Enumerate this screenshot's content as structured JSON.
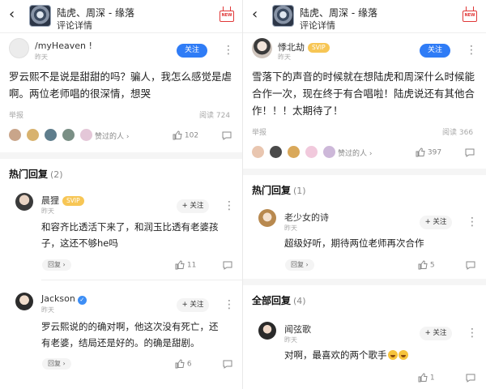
{
  "left": {
    "header": {
      "back_glyph": "‹",
      "title": "陆虎、周深 - 缘落",
      "subtitle": "评论详情",
      "new_badge": "NEW"
    },
    "post": {
      "user": "/myHeaven !",
      "time": "昨天",
      "follow": "关注",
      "text_line1": "罗云熙不是说是甜甜的吗？骗人，我怎么感觉是虐",
      "text_line2": "啊。两位老师唱的很深情，想哭",
      "report": "举报",
      "reads": "阅读 724",
      "liked_people": "赞过的人 ›",
      "likes": "102"
    },
    "hot_section": {
      "title": "热门回复",
      "count": "(2)"
    },
    "replies": [
      {
        "user": "晨狸",
        "badge": "SVIP",
        "time": "昨天",
        "follow": "+ 关注",
        "line1": "和容齐比透活下来了，和润玉比透有老婆孩",
        "line2": "子，这还不够he吗",
        "reply_btn": "回复 ›",
        "likes": "11"
      },
      {
        "user": "Jackson",
        "time": "昨天",
        "follow": "+ 关注",
        "line1": "罗云熙说的的确对啊，他这次没有死亡，还",
        "line2": "有老婆，结局还是好的。的确是甜剧。",
        "reply_btn": "回复 ›",
        "likes": "6"
      }
    ]
  },
  "right": {
    "header": {
      "back_glyph": "‹",
      "title": "陆虎、周深 - 缘落",
      "subtitle": "评论详情",
      "new_badge": "NEW"
    },
    "post": {
      "user": "悸北劫",
      "badge": "SVIP",
      "time": "昨天",
      "follow": "关注",
      "text_line1": "雪落下的声音的时候就在想陆虎和周深什么时候能",
      "text_line2": "合作一次，现在终于有合唱啦！陆虎说还有其他合",
      "text_line3": "作！！！太期待了！",
      "report": "举报",
      "reads": "阅读 366",
      "liked_people": "赞过的人 ›",
      "likes": "397"
    },
    "hot_section": {
      "title": "热门回复",
      "count": "(1)"
    },
    "hot_reply": {
      "user": "老少女的诗",
      "time": "昨天",
      "follow": "+ 关注",
      "line1": "超级好听，期待两位老师再次合作",
      "reply_btn": "回复 ›",
      "likes": "5"
    },
    "all_section": {
      "title": "全部回复",
      "count": "(4)"
    },
    "all_reply": {
      "user": "闻弦歌",
      "time": "昨天",
      "follow": "+ 关注",
      "line1": "对啊，最喜欢的两个歌手",
      "likes": "1"
    }
  },
  "icons": [
    "back-arrow-icon",
    "album-cover-icon",
    "new-tv-icon",
    "more-vertical-icon",
    "thumb-up-icon",
    "comment-icon",
    "verified-icon",
    "grin-emoji-icon"
  ],
  "colors": {
    "follow_blue": "#2f7cf6",
    "svip_gold": "#f7c655",
    "badge_red": "#e03838",
    "meta_gray": "#a8a8a8"
  }
}
